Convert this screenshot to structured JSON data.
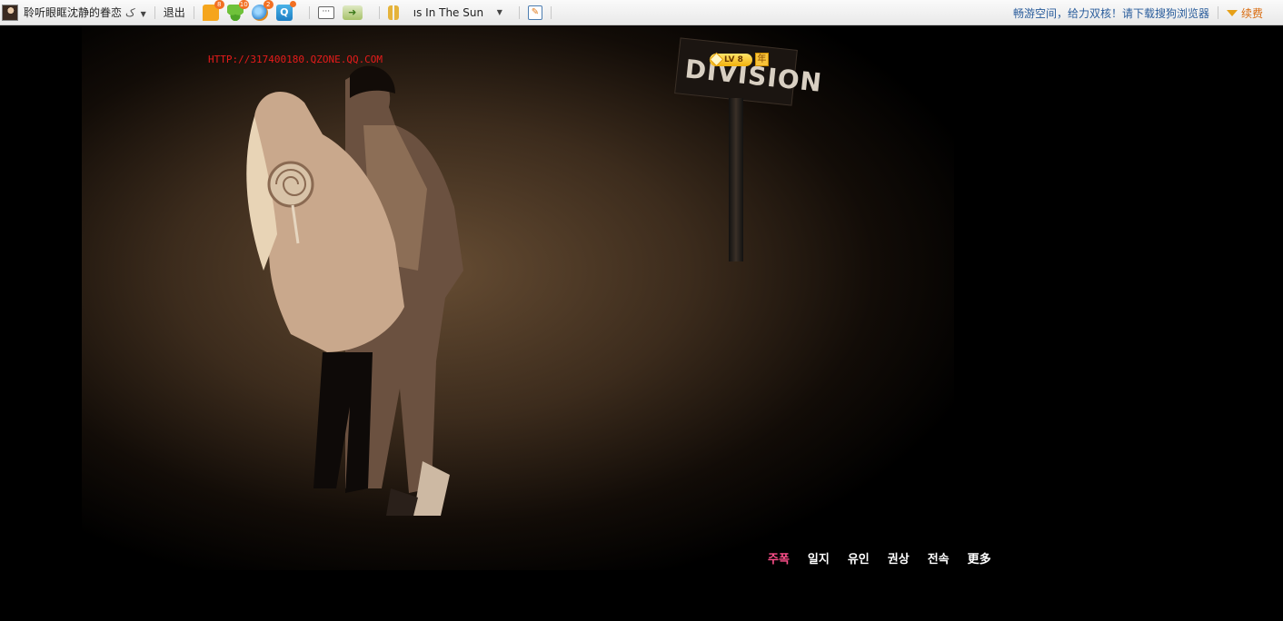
{
  "toolbar": {
    "username": "聆听眼眶沈静的眷恋",
    "switch_label": "ک",
    "logout": "退出",
    "icons": [
      {
        "name": "message-icon",
        "badge": "8"
      },
      {
        "name": "clover-icon",
        "badge": "10"
      },
      {
        "name": "globe-icon",
        "badge": "2"
      },
      {
        "name": "q-app-icon",
        "badge": ""
      },
      {
        "name": "chat-icon",
        "badge": ""
      },
      {
        "name": "arrow-icon",
        "badge": ""
      }
    ],
    "song": "ıs In The Sun",
    "promo": "畅游空间，给力双核！请下载搜狗浏览器",
    "renew": "续费"
  },
  "profile": {
    "url": "HTTP://317400180.QZONE.QQ.COM",
    "level": "LV 8",
    "year_badge": "年"
  },
  "photo": {
    "sign_text": "DIVISION"
  },
  "nav": {
    "items": [
      "주폭",
      "일지",
      "유인",
      "권상",
      "전속",
      "更多"
    ],
    "active_index": 0
  },
  "colors": {
    "url": "#e61b1b",
    "nav_active": "#ff4f8b",
    "nav_text": "#ffffff",
    "promo": "#2a5d9c",
    "renew": "#d96a0c"
  }
}
